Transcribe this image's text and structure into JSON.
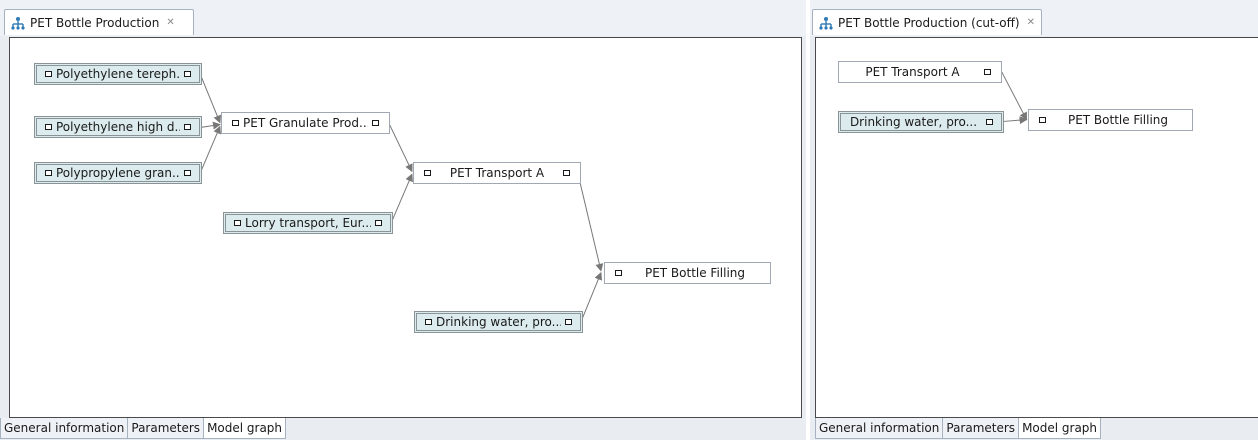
{
  "left_editor": {
    "tab_title": "PET Bottle Production",
    "nodes": [
      {
        "id": "pet-polymer",
        "label": "Polyethylene tereph...",
        "style": "teal"
      },
      {
        "id": "pe-high",
        "label": "Polyethylene high d...",
        "style": "teal"
      },
      {
        "id": "pp-gran",
        "label": "Polypropylene gran...",
        "style": "teal"
      },
      {
        "id": "pet-granulate",
        "label": "PET Granulate Prod...",
        "style": "plain"
      },
      {
        "id": "lorry",
        "label": "Lorry transport, Eur...",
        "style": "teal"
      },
      {
        "id": "transport-a",
        "label": "PET Transport A",
        "style": "plain"
      },
      {
        "id": "drinking-water",
        "label": "Drinking water, pro...",
        "style": "teal"
      },
      {
        "id": "bottle-filling",
        "label": "PET Bottle Filling",
        "style": "plain"
      }
    ],
    "bottom_tabs": [
      "General information",
      "Parameters",
      "Model graph"
    ],
    "active_bottom_tab": "Model graph"
  },
  "right_editor": {
    "tab_title": "PET Bottle Production (cut-off)",
    "nodes": [
      {
        "id": "transport-a",
        "label": "PET Transport A",
        "style": "plain"
      },
      {
        "id": "drinking-water",
        "label": "Drinking water, pro...",
        "style": "teal"
      },
      {
        "id": "bottle-filling",
        "label": "PET Bottle Filling",
        "style": "plain"
      }
    ],
    "bottom_tabs": [
      "General information",
      "Parameters",
      "Model graph"
    ],
    "active_bottom_tab": "Model graph"
  },
  "colors": {
    "teal_node_fill": "#dcebed",
    "canvas_border": "#4a4a4a",
    "chrome_bg": "#e9edf2",
    "edge": "#777777"
  },
  "icons": {
    "tab_icon": "process-tree-icon",
    "tab_close": "close-icon",
    "port": "port-square-icon"
  }
}
